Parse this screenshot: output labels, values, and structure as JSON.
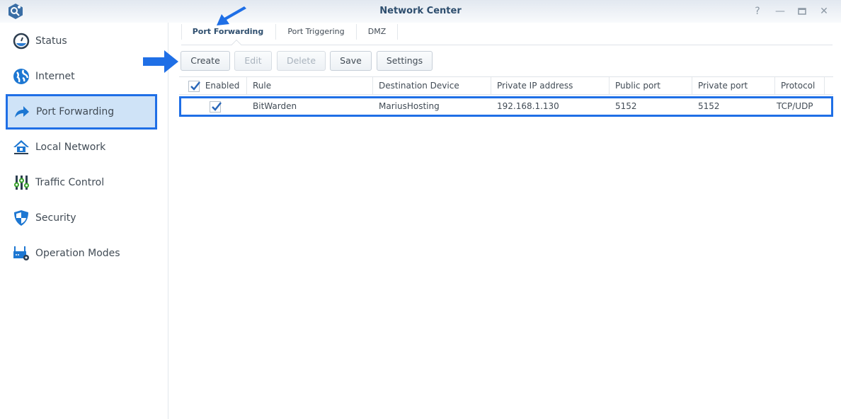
{
  "window": {
    "title": "Network Center",
    "controls": [
      "help-icon",
      "minimize-icon",
      "maximize-icon",
      "close-icon"
    ]
  },
  "sidebar": {
    "items": [
      {
        "label": "Status",
        "icon": "gauge-icon",
        "active": false
      },
      {
        "label": "Internet",
        "icon": "globe-icon",
        "active": false
      },
      {
        "label": "Port Forwarding",
        "icon": "forward-arrow-icon",
        "active": true
      },
      {
        "label": "Local Network",
        "icon": "home-network-icon",
        "active": false
      },
      {
        "label": "Traffic Control",
        "icon": "sliders-icon",
        "active": false
      },
      {
        "label": "Security",
        "icon": "shield-icon",
        "active": false
      },
      {
        "label": "Operation Modes",
        "icon": "router-gear-icon",
        "active": false
      }
    ]
  },
  "tabs": [
    {
      "label": "Port Forwarding",
      "active": true
    },
    {
      "label": "Port Triggering",
      "active": false
    },
    {
      "label": "DMZ",
      "active": false
    }
  ],
  "toolbar": {
    "create": "Create",
    "edit": "Edit",
    "delete": "Delete",
    "save": "Save",
    "settings": "Settings"
  },
  "table": {
    "columns": [
      "Enabled",
      "Rule",
      "Destination Device",
      "Private IP address",
      "Public port",
      "Private port",
      "Protocol"
    ],
    "rows": [
      {
        "enabled": true,
        "rule": "BitWarden",
        "destination_device": "MariusHosting",
        "private_ip": "192.168.1.130",
        "public_port": "5152",
        "private_port": "5152",
        "protocol": "TCP/UDP"
      }
    ]
  },
  "annotations": {
    "arrow_color": "#1f6fe6",
    "highlight_color": "#1f6fe6"
  }
}
